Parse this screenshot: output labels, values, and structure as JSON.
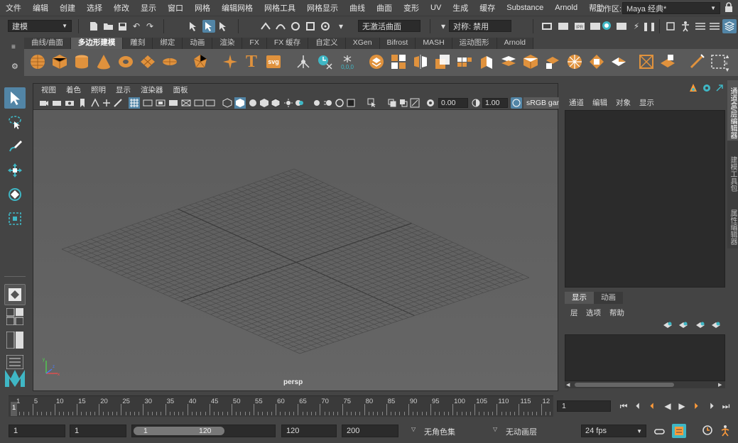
{
  "menubar": {
    "items": [
      "文件",
      "编辑",
      "创建",
      "选择",
      "修改",
      "显示",
      "窗口",
      "网格",
      "编辑网格",
      "网格工具",
      "网格显示",
      "曲线",
      "曲面",
      "变形",
      "UV",
      "生成",
      "缓存",
      "Substance",
      "Arnold",
      "帮助"
    ],
    "workspace_label": "工作区:",
    "workspace_value": "Maya 经典*"
  },
  "statusline": {
    "mode": "建模",
    "live_surface": "无激活曲面",
    "symmetry": "对称: 禁用"
  },
  "shelf": {
    "side_icons": [
      "menu-icon",
      "gear-icon"
    ],
    "tabs": [
      "曲线/曲面",
      "多边形建模",
      "雕刻",
      "绑定",
      "动画",
      "渲染",
      "FX",
      "FX 缓存",
      "自定义",
      "XGen",
      "Bifrost",
      "MASH",
      "运动图形",
      "Arnold"
    ],
    "active_tab": 1,
    "text_icon": "T",
    "svg_icon": "svg",
    "readout": "0,0,0"
  },
  "viewport": {
    "menu": [
      "视图",
      "着色",
      "照明",
      "显示",
      "渲染器",
      "面板"
    ],
    "gamma": "0.00",
    "exposure": "1.00",
    "color_space": "sRGB gam",
    "camera_label": "persp"
  },
  "right_panel": {
    "menu": [
      "通道",
      "编辑",
      "对象",
      "显示"
    ],
    "layer_tabs": [
      "显示",
      "动画"
    ],
    "layer_menu": [
      "层",
      "选项",
      "帮助"
    ],
    "vertical_tabs": [
      "通道盒/层编辑器",
      "建模工具包",
      "属性编辑器"
    ]
  },
  "timeslider": {
    "ticks": [
      "1",
      "5",
      "10",
      "15",
      "20",
      "25",
      "30",
      "35",
      "40",
      "45",
      "50",
      "55",
      "60",
      "65",
      "70",
      "75",
      "80",
      "85",
      "90",
      "95",
      "100",
      "105",
      "110",
      "115",
      "12"
    ],
    "current_frame": "1"
  },
  "range": {
    "start": "1",
    "playback_start": "1",
    "slider_start": "1",
    "slider_end": "120",
    "playback_end": "120",
    "end": "200",
    "character_set": "无角色集",
    "anim_layer": "无动画层",
    "fps": "24 fps"
  },
  "colors": {
    "accent": "#5285a6",
    "poly_orange": "#e0923d",
    "teal": "#3fb7c5"
  }
}
